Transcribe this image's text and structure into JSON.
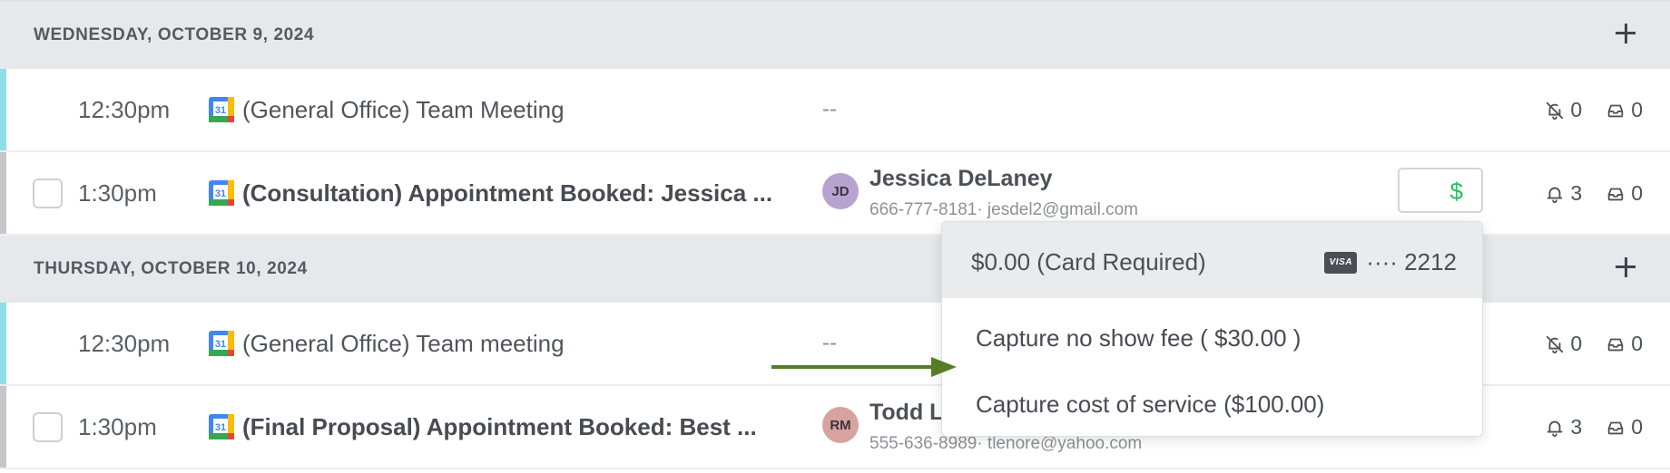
{
  "days": [
    {
      "label": "WEDNESDAY, OCTOBER 9, 2024",
      "events": [
        {
          "time": "12:30pm",
          "title": "(General Office) Team Meeting",
          "placeholder": "--",
          "reminders": "0",
          "messages": "0"
        },
        {
          "time": "1:30pm",
          "title": "(Consultation) Appointment Booked: Jessica ...",
          "contact": {
            "initials": "JD",
            "name": "Jessica DeLaney",
            "meta": "666-777-8181· jesdel2@gmail.com"
          },
          "payment_icon": "$",
          "reminders": "3",
          "messages": "0"
        }
      ]
    },
    {
      "label": "THURSDAY, OCTOBER 10, 2024",
      "events": [
        {
          "time": "12:30pm",
          "title": "(General Office) Team meeting",
          "placeholder": "--",
          "reminders": "0",
          "messages": "0"
        },
        {
          "time": "1:30pm",
          "title": "(Final Proposal) Appointment Booked: Best ...",
          "contact": {
            "initials": "RM",
            "name": "Todd L",
            "meta": "555-636-8989· tlenore@yahoo.com"
          },
          "reminders": "3",
          "messages": "0"
        }
      ]
    }
  ],
  "payment_menu": {
    "amount": "$0.00 (Card Required)",
    "card_brand": "VISA",
    "card_number": "···· 2212",
    "options": [
      "Capture no show fee ( $30.00 )",
      "Capture cost of service ($100.00)"
    ]
  },
  "colors": {
    "accent_general": "#8fdde8",
    "accent_appointment": "#c4c6c9",
    "payment_green": "#22c05a",
    "arrow_green": "#567d23",
    "avatar_jd": "#b7a2d0",
    "avatar_rm": "#d8a39f"
  },
  "icons": [
    "google-calendar-icon",
    "bell-off-icon",
    "bell-icon",
    "inbox-icon",
    "plus-icon",
    "dollar-icon",
    "visa-card-icon"
  ]
}
